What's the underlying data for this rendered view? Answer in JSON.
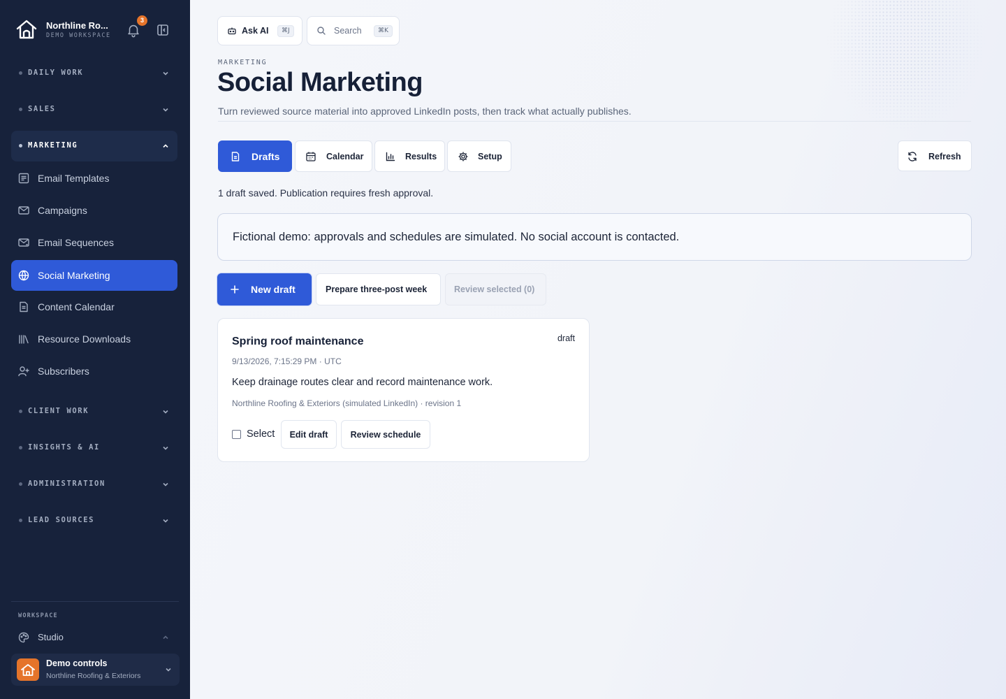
{
  "sidebar": {
    "brand": {
      "title": "Northline Ro...",
      "subtitle": "DEMO WORKSPACE",
      "notification_count": "3"
    },
    "groups": {
      "daily_work": "DAILY WORK",
      "sales": "SALES",
      "marketing": "MARKETING",
      "client_work": "CLIENT WORK",
      "insights_ai": "INSIGHTS & AI",
      "administration": "ADMINISTRATION",
      "lead_sources": "LEAD SOURCES"
    },
    "marketing_items": [
      {
        "label": "Email Templates",
        "icon": "template-icon"
      },
      {
        "label": "Campaigns",
        "icon": "mail-icon"
      },
      {
        "label": "Email Sequences",
        "icon": "mail-sequence-icon"
      },
      {
        "label": "Social Marketing",
        "icon": "globe-icon",
        "active": true
      },
      {
        "label": "Content Calendar",
        "icon": "document-icon"
      },
      {
        "label": "Resource Downloads",
        "icon": "library-icon"
      },
      {
        "label": "Subscribers",
        "icon": "user-plus-icon"
      }
    ],
    "workspace_label": "WORKSPACE",
    "studio_label": "Studio",
    "demo": {
      "title": "Demo controls",
      "subtitle": "Northline Roofing & Exteriors"
    }
  },
  "topbar": {
    "ask_ai": {
      "label": "Ask AI",
      "shortcut": "⌘J"
    },
    "search": {
      "placeholder": "Search",
      "shortcut": "⌘K"
    }
  },
  "header": {
    "eyebrow": "MARKETING",
    "title": "Social Marketing",
    "description": "Turn reviewed source material into approved LinkedIn posts, then track what actually publishes."
  },
  "tabs": [
    {
      "label": "Drafts",
      "icon": "document-icon",
      "active": true
    },
    {
      "label": "Calendar",
      "icon": "calendar-icon"
    },
    {
      "label": "Results",
      "icon": "bar-chart-icon"
    },
    {
      "label": "Setup",
      "icon": "gear-icon"
    }
  ],
  "refresh_label": "Refresh",
  "status_text": "1 draft saved. Publication requires fresh approval.",
  "notice": "Fictional demo: approvals and schedules are simulated. No social account is contacted.",
  "actions": {
    "new_draft": "New draft",
    "prepare_week": "Prepare three-post week",
    "review_selected": "Review selected (0)"
  },
  "draft_card": {
    "title": "Spring roof maintenance",
    "status": "draft",
    "timestamp": "9/13/2026, 7:15:29 PM · UTC",
    "body": "Keep drainage routes clear and record maintenance work.",
    "meta": "Northline Roofing & Exteriors (simulated LinkedIn) · revision 1",
    "select_label": "Select",
    "checked": false,
    "edit_label": "Edit draft",
    "review_label": "Review schedule"
  },
  "colors": {
    "sidebar_bg": "#17223b",
    "accent": "#2f5ad8",
    "brand_orange": "#e5742a"
  }
}
